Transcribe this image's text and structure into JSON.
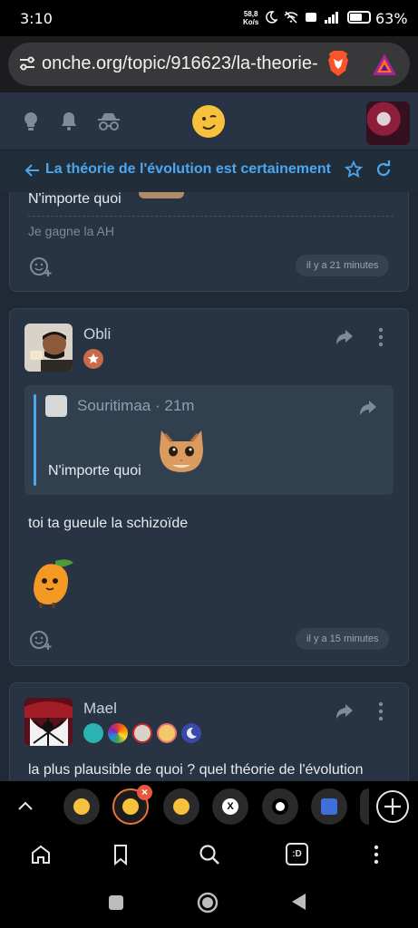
{
  "status_bar": {
    "time": "3:10",
    "net_speed_value": "58,8",
    "net_speed_unit": "Ko/s",
    "battery": "63%"
  },
  "browser": {
    "url": "onche.org/topic/916623/la-theorie-de"
  },
  "topic": {
    "title": "La théorie de l'évolution est certainement"
  },
  "posts": [
    {
      "truncated_text": "N'importe quoi",
      "signature": "Je gagne la AH",
      "time": "il y a 21 minutes"
    },
    {
      "author": "Obli",
      "quote": {
        "author": "Souritimaa · 21m",
        "text": "N'importe quoi"
      },
      "text": "toi ta gueule la schizoïde",
      "time": "il y a 15 minutes"
    },
    {
      "author": "Mael",
      "text": "la plus plausible de quoi ? quel théorie de l'évolution"
    }
  ],
  "tabs": {
    "close_symbol": "×",
    "x_tab_label": "X"
  },
  "toolbar": {
    "chat_label": ":D"
  },
  "colors": {
    "accent": "#4ba7f0",
    "card": "#283443",
    "active_tab": "#e8743b"
  }
}
